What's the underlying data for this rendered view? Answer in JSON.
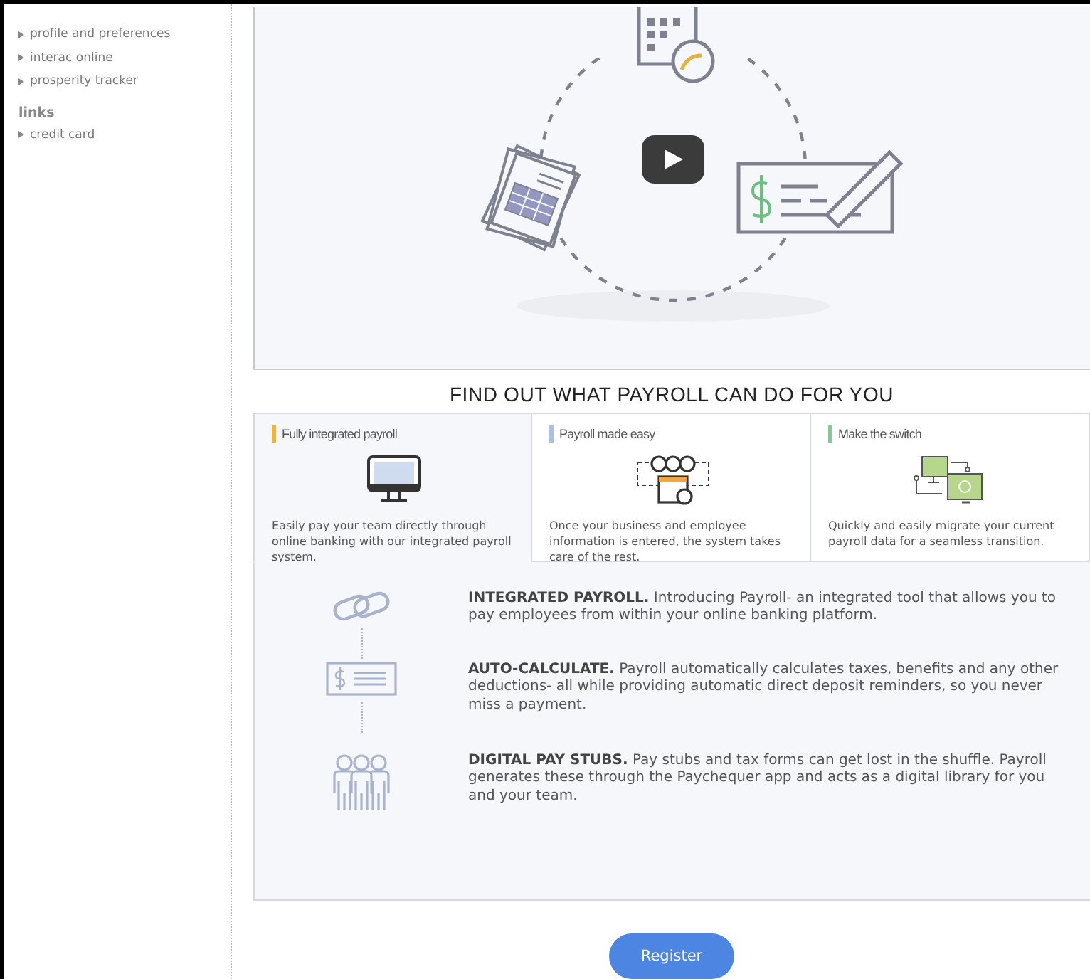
{
  "sidebar": {
    "items": [
      {
        "label": "profile and preferences"
      },
      {
        "label": "interac online"
      },
      {
        "label": "prosperity tracker"
      }
    ],
    "links_title": "links",
    "links": [
      {
        "label": "credit card"
      }
    ]
  },
  "section_title": "FIND OUT WHAT PAYROLL CAN DO FOR YOU",
  "tabs": [
    {
      "label": "Fully integrated payroll",
      "color": "#f0b43a",
      "selected": true,
      "description": "Easily pay your team directly through online banking with our integrated payroll system."
    },
    {
      "label": "Payroll made easy",
      "color": "#a9c0e8",
      "selected": false,
      "description": "Once your business and employee information is entered, the system takes care of the rest."
    },
    {
      "label": "Make the switch",
      "color": "#8cc49a",
      "selected": false,
      "description": "Quickly and easily migrate your current payroll data for a seamless transition."
    }
  ],
  "features": [
    {
      "text": "**INTEGRATED PAYROLL.** Introducing Payroll- an integrated tool that allows you to pay employees from within your online banking platform."
    },
    {
      "text": "**AUTO-CALCULATE.** Payroll automatically calculates taxes, benefits and any other deductions- all while providing automatic direct deposit reminders, so you never miss a payment."
    },
    {
      "text": "**DIGITAL PAY STUBS.** Pay stubs and tax forms can get lost in the shuffle. Payroll generates these through the Paychequer app and acts as a digital library for you and your team."
    }
  ],
  "register_button": "Register"
}
